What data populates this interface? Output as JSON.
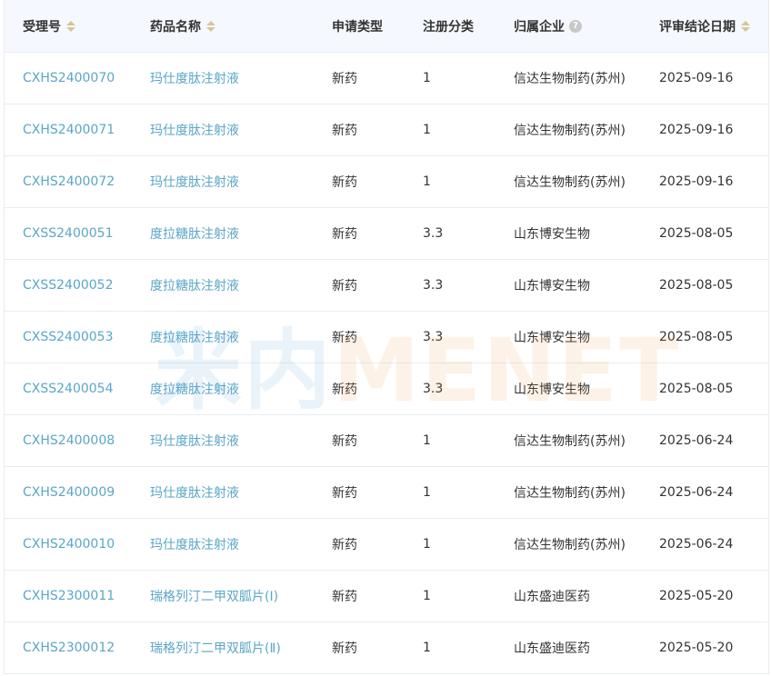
{
  "header": {
    "col_id": "受理号",
    "col_name": "药品名称",
    "col_type": "申请类型",
    "col_class": "注册分类",
    "col_company": "归属企业",
    "col_date": "评审结论日期"
  },
  "watermark": {
    "part1": "米内",
    "part2": "MENET"
  },
  "rows": [
    {
      "id": "CXHS2400070",
      "name": "玛仕度肽注射液",
      "type": "新药",
      "class": "1",
      "company": "信达生物制药(苏州)",
      "date": "2025-09-16"
    },
    {
      "id": "CXHS2400071",
      "name": "玛仕度肽注射液",
      "type": "新药",
      "class": "1",
      "company": "信达生物制药(苏州)",
      "date": "2025-09-16"
    },
    {
      "id": "CXHS2400072",
      "name": "玛仕度肽注射液",
      "type": "新药",
      "class": "1",
      "company": "信达生物制药(苏州)",
      "date": "2025-09-16"
    },
    {
      "id": "CXSS2400051",
      "name": "度拉糖肽注射液",
      "type": "新药",
      "class": "3.3",
      "company": "山东博安生物",
      "date": "2025-08-05"
    },
    {
      "id": "CXSS2400052",
      "name": "度拉糖肽注射液",
      "type": "新药",
      "class": "3.3",
      "company": "山东博安生物",
      "date": "2025-08-05"
    },
    {
      "id": "CXSS2400053",
      "name": "度拉糖肽注射液",
      "type": "新药",
      "class": "3.3",
      "company": "山东博安生物",
      "date": "2025-08-05"
    },
    {
      "id": "CXSS2400054",
      "name": "度拉糖肽注射液",
      "type": "新药",
      "class": "3.3",
      "company": "山东博安生物",
      "date": "2025-08-05"
    },
    {
      "id": "CXHS2400008",
      "name": "玛仕度肽注射液",
      "type": "新药",
      "class": "1",
      "company": "信达生物制药(苏州)",
      "date": "2025-06-24"
    },
    {
      "id": "CXHS2400009",
      "name": "玛仕度肽注射液",
      "type": "新药",
      "class": "1",
      "company": "信达生物制药(苏州)",
      "date": "2025-06-24"
    },
    {
      "id": "CXHS2400010",
      "name": "玛仕度肽注射液",
      "type": "新药",
      "class": "1",
      "company": "信达生物制药(苏州)",
      "date": "2025-06-24"
    },
    {
      "id": "CXHS2300011",
      "name": "瑞格列汀二甲双胍片(Ⅰ)",
      "type": "新药",
      "class": "1",
      "company": "山东盛迪医药",
      "date": "2025-05-20"
    },
    {
      "id": "CXHS2300012",
      "name": "瑞格列汀二甲双胍片(Ⅱ)",
      "type": "新药",
      "class": "1",
      "company": "山东盛迪医药",
      "date": "2025-05-20"
    }
  ]
}
